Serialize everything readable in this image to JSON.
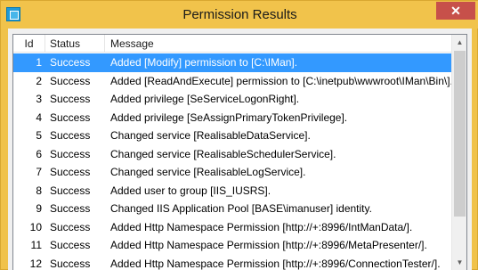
{
  "window": {
    "title": "Permission Results",
    "close_label": "✕",
    "accent_color": "#f1c34b",
    "close_color": "#c7504a",
    "selection_color": "#3399ff"
  },
  "icons": {
    "app": "app-icon",
    "scroll_up": "chevron-up-icon",
    "scroll_down": "chevron-down-icon"
  },
  "table": {
    "columns": [
      "Id",
      "Status",
      "Message"
    ],
    "selected_row": 0,
    "rows": [
      {
        "id": "1",
        "status": "Success",
        "message": "Added [Modify] permission to [C:\\IMan]."
      },
      {
        "id": "2",
        "status": "Success",
        "message": "Added [ReadAndExecute] permission to [C:\\inetpub\\wwwroot\\IMan\\Bin\\]."
      },
      {
        "id": "3",
        "status": "Success",
        "message": "Added privilege [SeServiceLogonRight]."
      },
      {
        "id": "4",
        "status": "Success",
        "message": "Added privilege [SeAssignPrimaryTokenPrivilege]."
      },
      {
        "id": "5",
        "status": "Success",
        "message": "Changed service [RealisableDataService]."
      },
      {
        "id": "6",
        "status": "Success",
        "message": "Changed service [RealisableSchedulerService]."
      },
      {
        "id": "7",
        "status": "Success",
        "message": "Changed service [RealisableLogService]."
      },
      {
        "id": "8",
        "status": "Success",
        "message": "Added user to group [IIS_IUSRS]."
      },
      {
        "id": "9",
        "status": "Success",
        "message": "Changed IIS Application Pool [BASE\\imanuser] identity."
      },
      {
        "id": "10",
        "status": "Success",
        "message": "Added Http Namespace Permission [http://+:8996/IntManData/]."
      },
      {
        "id": "11",
        "status": "Success",
        "message": "Added Http Namespace Permission [http://+:8996/MetaPresenter/]."
      },
      {
        "id": "12",
        "status": "Success",
        "message": "Added Http Namespace Permission [http://+:8996/ConnectionTester/]."
      }
    ]
  }
}
